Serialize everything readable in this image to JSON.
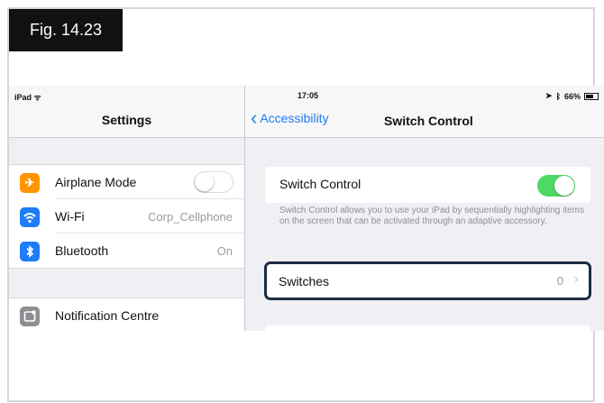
{
  "figure": {
    "label": "Fig. 14.23"
  },
  "status_bar": {
    "device": "iPad",
    "wifi_icon": "wifi-icon",
    "time": "17:05",
    "battery": "66%"
  },
  "settings": {
    "title": "Settings",
    "rows": [
      {
        "label": "Airplane Mode",
        "icon": "airplane-icon",
        "icon_color": "#ff9500",
        "control": "toggle-off"
      },
      {
        "label": "Wi-Fi",
        "value": "Corp_Cellphone",
        "icon": "wifi-icon",
        "icon_color": "#1e7cf6"
      },
      {
        "label": "Bluetooth",
        "value": "On",
        "icon": "bluetooth-icon",
        "icon_color": "#1e7cf6"
      }
    ],
    "notification_row": {
      "label": "Notification Centre",
      "icon": "notification-centre-icon",
      "icon_color": "#8e8e93"
    }
  },
  "detail": {
    "back_label": "Accessibility",
    "title": "Switch Control",
    "switch_control_label": "Switch Control",
    "switch_control_on": true,
    "description": "Switch Control allows you to use your iPad by sequentially highlighting items on the screen that can be activated through an adaptive accessory.",
    "switches_label": "Switches",
    "switches_value": "0"
  },
  "colors": {
    "accent_blue": "#1e7cf6",
    "toggle_green": "#4cd964",
    "focus_ring": "#1c2d44"
  }
}
